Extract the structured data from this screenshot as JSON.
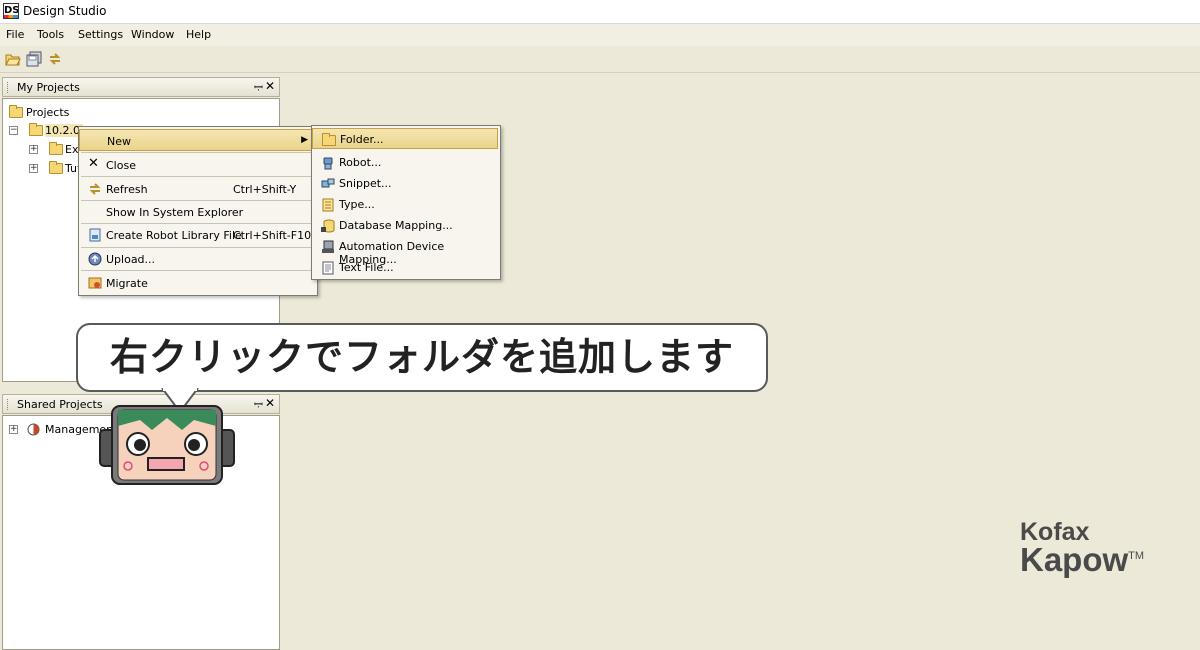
{
  "window": {
    "title": "Design Studio",
    "app_icon_text": "DS"
  },
  "menubar": [
    {
      "label": "File"
    },
    {
      "label": "Tools"
    },
    {
      "label": "Settings"
    },
    {
      "label": "Window"
    },
    {
      "label": "Help"
    }
  ],
  "toolbar": {
    "icons": [
      "open-folder-icon",
      "save-all-icon",
      "refresh-icon"
    ]
  },
  "my_projects": {
    "title": "My Projects",
    "tree": [
      {
        "label": "Projects"
      },
      {
        "label": "10.2.0."
      },
      {
        "label": "Ex"
      },
      {
        "label": "Tut"
      }
    ]
  },
  "shared_projects": {
    "title": "Shared Projects",
    "tree": [
      {
        "label": "Management C"
      }
    ]
  },
  "context_menu": {
    "items": [
      {
        "label": "New",
        "shortcut": "",
        "has_submenu": true,
        "highlighted": true
      },
      {
        "label": "Close",
        "shortcut": ""
      },
      {
        "label": "Refresh",
        "shortcut": "Ctrl+Shift-Y"
      },
      {
        "label": "Show In System Explorer",
        "shortcut": ""
      },
      {
        "label": "Create Robot Library File",
        "shortcut": "Ctrl+Shift-F10"
      },
      {
        "label": "Upload...",
        "shortcut": ""
      },
      {
        "label": "Migrate",
        "shortcut": ""
      }
    ]
  },
  "submenu": {
    "items": [
      {
        "label": "Folder...",
        "highlighted": true
      },
      {
        "label": "Robot..."
      },
      {
        "label": "Snippet..."
      },
      {
        "label": "Type..."
      },
      {
        "label": "Database Mapping..."
      },
      {
        "label": "Automation Device Mapping..."
      },
      {
        "label": "Text File..."
      }
    ]
  },
  "callout": {
    "text": "右クリックでフォルダを追加します"
  },
  "logo": {
    "line1": "Kofax",
    "line2": "Kapow",
    "tm": "TM"
  },
  "colors": {
    "background": "#ece9d8",
    "highlight": "#ead48a",
    "panel": "#ffffff"
  }
}
